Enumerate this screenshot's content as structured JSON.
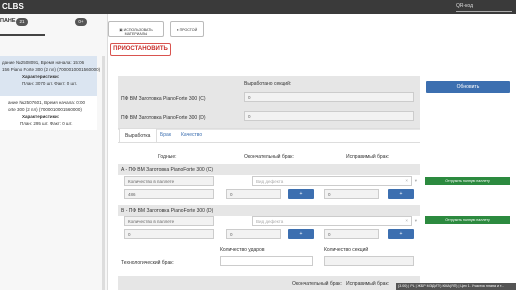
{
  "header": {
    "logo": "CLBS",
    "qr_label": "QR-код"
  },
  "left": {
    "tab_label": "ПАНЕ",
    "tab_badge": "21",
    "second_badge": "0+",
    "orders": [
      {
        "line1": "дание №2508091, Время начала: 15:06",
        "line2": "156 Piano Forte 300 (2 пл) (7000010001560000)",
        "line3": "Характеристики:",
        "line4": "План: 3070 шт. Факт: 0 шт."
      },
      {
        "line1": "ание №2507601, Время начала: 0:00",
        "line2": "orte 300 (2 пл) (7000010001560000)",
        "line3": "Характеристики:",
        "line4": "План: 295 шт. Факт: 0 шт."
      }
    ]
  },
  "toolbar": {
    "btn1": "ИСПОЛЬЗОВАТЬ МАТЕРИАЛЫ",
    "btn2": "ПРОСТОЙ",
    "stop": "ПРИОСТАНОВИТЬ"
  },
  "summary": {
    "produced_sections": "Выработано секций:",
    "row_c_label": "ПФ ВМ Заготовка PianoForte 300 (C)",
    "row_c_value": "0",
    "row_d_label": "ПФ ВМ Заготовка PianoForte 300 (D)",
    "row_d_value": "0",
    "refresh": "Обновить"
  },
  "tabs": [
    "Выработка",
    "Брак",
    "Качество"
  ],
  "columns": {
    "good": "Годные:",
    "final_defect": "Окончательный брак:",
    "fixable_defect": "Исправимый брак:"
  },
  "sections": [
    {
      "title": "A - ПФ ВМ Заготовка PianoForte 300 (C)",
      "qty_placeholder": "Количество в паллете",
      "qty_value": "486",
      "defect_placeholder": "Вид дефекта",
      "final_value": "0",
      "fix_value": "0",
      "btn": "Отгрузить полную паллету"
    },
    {
      "title": "B - ПФ ВМ Заготовка PianoForte 300 (D)",
      "qty_placeholder": "Количество в паллете",
      "qty_value": "0",
      "defect_placeholder": "Вид дефекта",
      "final_value": "0",
      "fix_value": "0",
      "btn": "Отгрузить полную паллету"
    }
  ],
  "tech": {
    "label": "Технологический брак:",
    "hits": "Количество ударов",
    "sections": "Количество секций"
  },
  "footer": {
    "final_defect": "Окончательный брак:",
    "fixable_defect": "Исправимый брак:",
    "status": "(3.00) | PL | ЖБР МЭДИТ!) КМА(ЯП) | Цех 1. Участок плана и т..."
  },
  "colors": {
    "primary": "#3c6fb0",
    "success": "#2c8a3f",
    "danger": "#d9534f",
    "topbar": "#3a3a3a"
  }
}
